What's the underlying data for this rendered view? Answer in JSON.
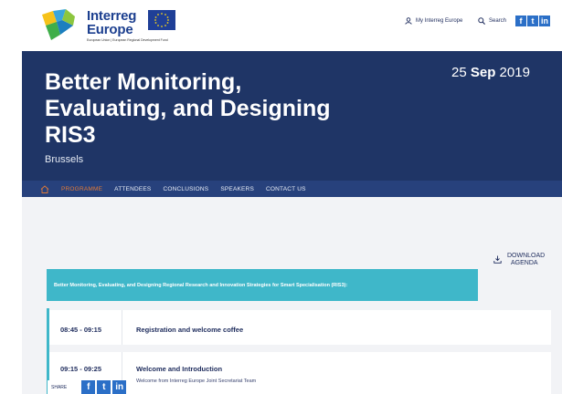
{
  "header": {
    "logo_line1": "Interreg",
    "logo_line2": "Europe",
    "logo_sub": "European Union | European Regional Development Fund",
    "my_link": "My Interreg Europe",
    "search": "Search",
    "social": [
      "f",
      "t",
      "in"
    ]
  },
  "hero": {
    "title": "Better Monitoring, Evaluating, and Designing RIS3",
    "city": "Brussels",
    "date_day": "25",
    "date_month": "Sep",
    "date_year": "2019"
  },
  "nav": {
    "items": [
      "PROGRAMME",
      "ATTENDEES",
      "CONCLUSIONS",
      "SPEAKERS",
      "CONTACT US"
    ],
    "active": "PROGRAMME"
  },
  "download": {
    "line1": "DOWNLOAD",
    "line2": "AGENDA"
  },
  "agenda": {
    "header": "Better Monitoring, Evaluating, and Designing Regional Research and Innovation Strategies for Smart Specialisation (RIS3):",
    "rows": [
      {
        "time": "08:45 - 09:15",
        "title": "Registration and welcome coffee",
        "desc": ""
      },
      {
        "time": "09:15 - 09:25",
        "title": "Welcome and Introduction",
        "desc": "Welcome from Interreg Europe Joint Secretariat Team"
      }
    ]
  },
  "share": {
    "label": "SHARE",
    "social": [
      "f",
      "t",
      "in"
    ]
  },
  "colors": {
    "navy": "#1f3566",
    "nav": "#27417c",
    "teal": "#3fb7c9",
    "orange": "#e07a38",
    "social_blue": "#2b6fc7"
  }
}
